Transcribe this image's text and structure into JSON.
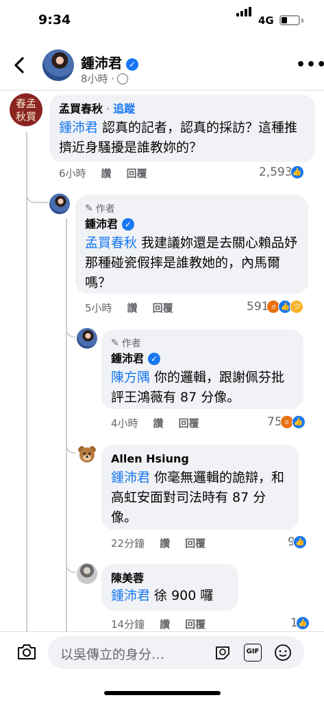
{
  "status_bar": {
    "time": "9:34",
    "network": "4G",
    "battery_level": 0.35
  },
  "post_header": {
    "back_icon": "chevron-left-icon",
    "author_name": "鍾沛君",
    "meta": "8小時 ·",
    "more_icon": "more-horizontal-icon"
  },
  "comments": [
    {
      "name": "孟買春秋",
      "sep": " · ",
      "follow": "追蹤",
      "avatar_text": "春孟秋買",
      "mention": "鍾沛君",
      "text": " 認真的記者，認真的採訪？這種推擠近身騷擾是誰教妳的？",
      "time": "6小時",
      "like": "讚",
      "reply": "回覆",
      "reaction_count": "2,593"
    },
    {
      "author_tag": "作者",
      "name": "鍾沛君",
      "mention": "孟買春秋",
      "text": " 我建議妳還是去關心賴品妤那種碰瓷假摔是誰教她的，內馬爾嗎？",
      "time": "5小時",
      "like": "讚",
      "reply": "回覆",
      "reaction_count": "591"
    },
    {
      "author_tag": "作者",
      "name": "鍾沛君",
      "mention": "陳方隅",
      "text": " 你的邏輯，跟謝佩芬批評王鴻薇有 87 分像。",
      "time": "4小時",
      "like": "讚",
      "reply": "回覆",
      "reaction_count": "75"
    },
    {
      "name": "Allen Hsiung",
      "mention": "鍾沛君",
      "text": " 你毫無邏輯的詭辯，和高虹安面對司法時有 87 分像。",
      "time": "22分鐘",
      "like": "讚",
      "reply": "回覆",
      "reaction_count": "9"
    },
    {
      "name": "陳美蓉",
      "mention": "鍾沛君",
      "text": " 徐 900 囉",
      "time": "14分鐘",
      "like": "讚",
      "reply": "回覆",
      "reaction_count": "1"
    }
  ],
  "composer": {
    "placeholder": "以吳傳立的身分…",
    "camera_icon": "camera-icon",
    "sticker_icon": "sticker-icon",
    "gif_label": "GIF",
    "emoji_icon": "emoji-icon"
  },
  "colors": {
    "link": "#1877f2",
    "bubble": "#f0f2f5",
    "meta": "#65676b",
    "like": "#1877f2",
    "angry": "#e9710f",
    "haha": "#f7b125"
  }
}
